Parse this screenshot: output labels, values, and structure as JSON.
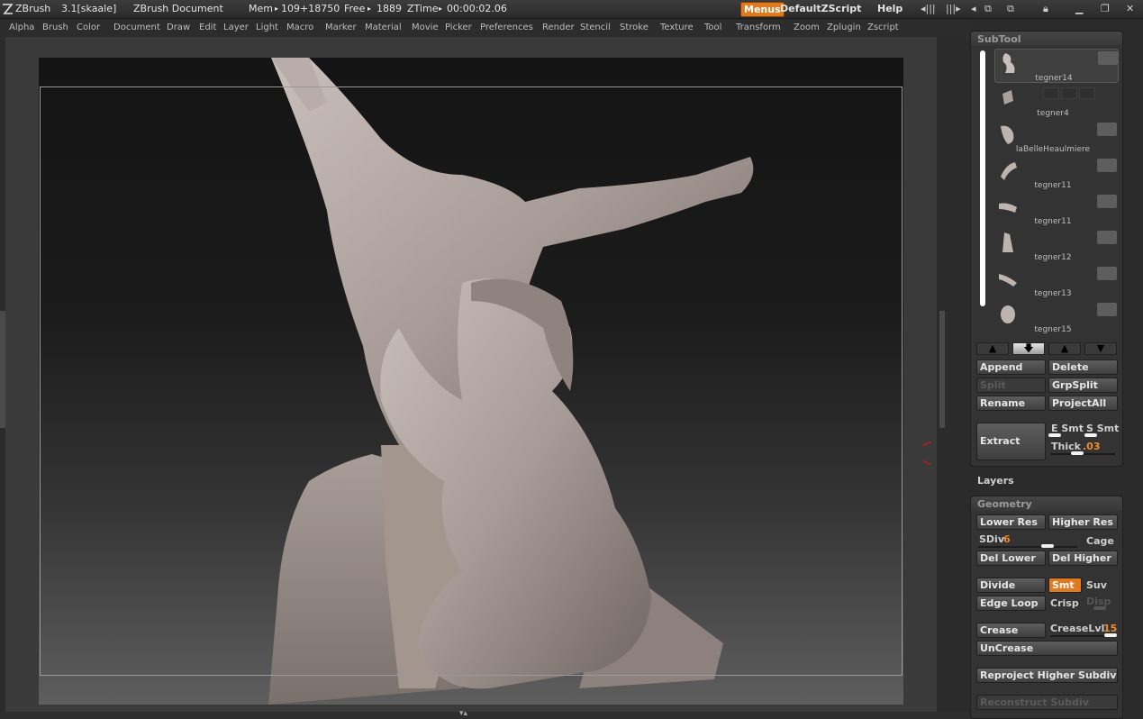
{
  "titlebar": {
    "app": "ZBrush",
    "version": "3.1[skaale]",
    "document": "ZBrush Document",
    "mem_label": "Mem",
    "mem_value": "109+18750",
    "free_label": "Free",
    "free_value": "1889",
    "ztime_label": "ZTime",
    "ztime_value": "00:00:02.06",
    "menus": "Menus",
    "zscript": "DefaultZScript",
    "help": "Help"
  },
  "menubar": [
    "Alpha",
    "Brush",
    "Color",
    "Document",
    "Draw",
    "Edit",
    "Layer",
    "Light",
    "Macro",
    "Marker",
    "Material",
    "Movie",
    "Picker",
    "Preferences",
    "Render",
    "Stencil",
    "Stroke",
    "Texture",
    "Tool",
    "Transform",
    "Zoom",
    "Zplugin",
    "Zscript"
  ],
  "subtool": {
    "title": "SubTool",
    "items": [
      {
        "name": "tegner14",
        "selected": true
      },
      {
        "name": "tegner4",
        "selected": false
      },
      {
        "name": "laBelleHeaulmiere",
        "selected": false
      },
      {
        "name": "tegner11",
        "selected": false
      },
      {
        "name": "tegner11",
        "selected": false
      },
      {
        "name": "tegner12",
        "selected": false
      },
      {
        "name": "tegner13",
        "selected": false
      },
      {
        "name": "tegner15",
        "selected": false
      }
    ],
    "append": "Append",
    "delete": "Delete",
    "split": "Split",
    "grpsplit": "GrpSplit",
    "rename": "Rename",
    "projectall": "ProjectAll",
    "extract": "Extract",
    "esmt": "E Smt",
    "ssmt": "S Smt",
    "thick_label": "Thick",
    "thick_value": ".03"
  },
  "layers": {
    "title": "Layers"
  },
  "geometry": {
    "title": "Geometry",
    "lower_res": "Lower Res",
    "higher_res": "Higher Res",
    "sdiv_label": "SDiv",
    "sdiv_value": "6",
    "cage": "Cage",
    "del_lower": "Del Lower",
    "del_higher": "Del Higher",
    "divide": "Divide",
    "smt": "Smt",
    "suv": "Suv",
    "edge_loop": "Edge Loop",
    "crisp": "Crisp",
    "disp": "Disp",
    "crease": "Crease",
    "creaselvl_label": "CreaseLvl",
    "creaselvl_value": "15",
    "uncrease": "UnCrease",
    "reproject": "Reproject Higher Subdiv",
    "reconstruct": "Reconstruct Subdiv"
  }
}
